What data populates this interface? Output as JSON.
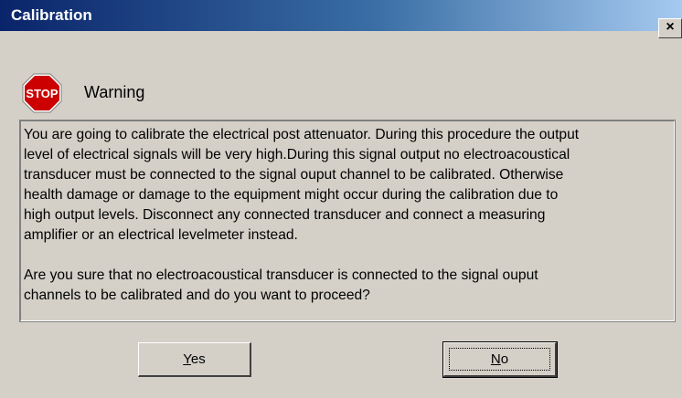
{
  "window": {
    "title": "Calibration",
    "close_glyph": "×"
  },
  "dialog": {
    "icon": "stop-sign-icon",
    "icon_text": "STOP",
    "heading": "Warning",
    "message_paragraph_1": "You are going to calibrate the electrical post attenuator. During this procedure the output\nlevel of electrical signals will be very high.During this signal output no electroacoustical\ntransducer must be connected to the signal ouput channel to be calibrated. Otherwise\nhealth damage or damage to the equipment might occur during the calibration due to\nhigh output levels. Disconnect any connected transducer and connect a measuring\namplifier or an electrical levelmeter instead.",
    "message_paragraph_2": "Are you sure that no electroacoustical transducer is connected to the signal ouput\nchannels to be calibrated and do you want to proceed?"
  },
  "buttons": {
    "yes": {
      "mnemonic": "Y",
      "rest": "es"
    },
    "no": {
      "mnemonic": "N",
      "rest": "o"
    }
  },
  "colors": {
    "titlebar_start": "#0a246a",
    "titlebar_end": "#a6caf0",
    "face": "#d4d0c8",
    "stop_red": "#cc0000"
  }
}
